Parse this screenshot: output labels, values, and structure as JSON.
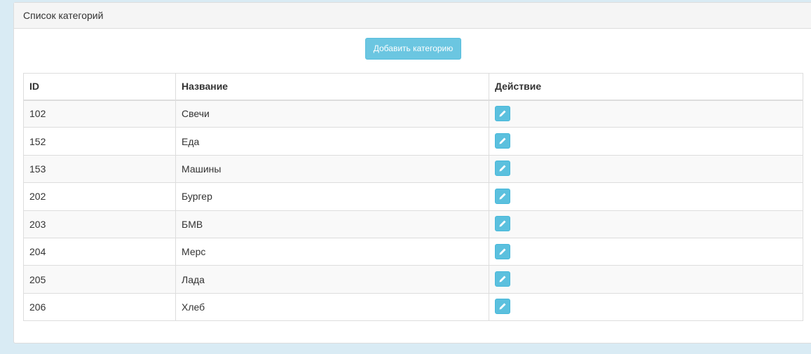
{
  "panel": {
    "title": "Список категорий",
    "add_button_label": "Добавить категорию"
  },
  "table": {
    "headers": [
      "ID",
      "Название",
      "Действие"
    ],
    "rows": [
      {
        "id": "102",
        "name": "Свечи"
      },
      {
        "id": "152",
        "name": "Еда"
      },
      {
        "id": "153",
        "name": "Машины"
      },
      {
        "id": "202",
        "name": "Бургер"
      },
      {
        "id": "203",
        "name": "БМВ"
      },
      {
        "id": "204",
        "name": "Мерс"
      },
      {
        "id": "205",
        "name": "Лада"
      },
      {
        "id": "206",
        "name": "Хлеб"
      }
    ],
    "action_icon": "pencil-icon"
  },
  "colors": {
    "info": "#5bc0de",
    "page_background": "#d9ebf4"
  }
}
